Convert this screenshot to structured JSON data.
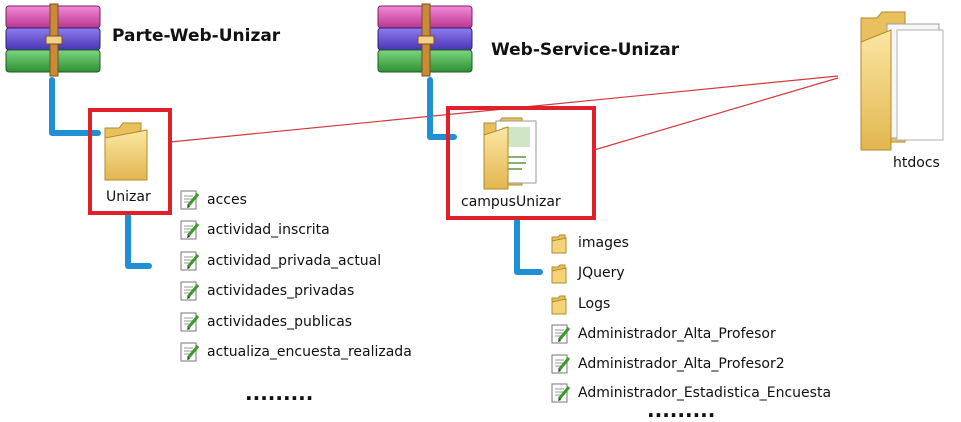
{
  "archives": [
    {
      "title": "Parte-Web-Unizar",
      "icon": "winrar-archive-icon"
    },
    {
      "title": "Web-Service-Unizar",
      "icon": "winrar-archive-icon"
    }
  ],
  "folders": {
    "unizar": {
      "label": "Unizar",
      "icon": "folder-icon"
    },
    "campus": {
      "label": "campusUnizar",
      "icon": "folder-with-documents-icon"
    },
    "htdocs": {
      "label": "htdocs",
      "icon": "open-folder-icon"
    }
  },
  "unizar_files": [
    {
      "name": "acces",
      "icon": "php-script-icon"
    },
    {
      "name": "actividad_inscrita",
      "icon": "php-script-icon"
    },
    {
      "name": "actividad_privada_actual",
      "icon": "php-script-icon"
    },
    {
      "name": "actividades_privadas",
      "icon": "php-script-icon"
    },
    {
      "name": "actividades_publicas",
      "icon": "php-script-icon"
    },
    {
      "name": "actualiza_encuesta_realizada",
      "icon": "php-script-icon"
    }
  ],
  "campus_items": [
    {
      "name": "images",
      "icon": "folder-icon"
    },
    {
      "name": "JQuery",
      "icon": "folder-icon"
    },
    {
      "name": "Logs",
      "icon": "folder-icon"
    },
    {
      "name": "Administrador_Alta_Profesor",
      "icon": "php-script-icon"
    },
    {
      "name": "Administrador_Alta_Profesor2",
      "icon": "php-script-icon"
    },
    {
      "name": "Administrador_Estadistica_Encuesta",
      "icon": "php-script-icon"
    }
  ],
  "ellipsis": ".........",
  "colors": {
    "connector": "#1f8fd6",
    "highlight": "#e0202a",
    "link": "#d43a3a"
  }
}
